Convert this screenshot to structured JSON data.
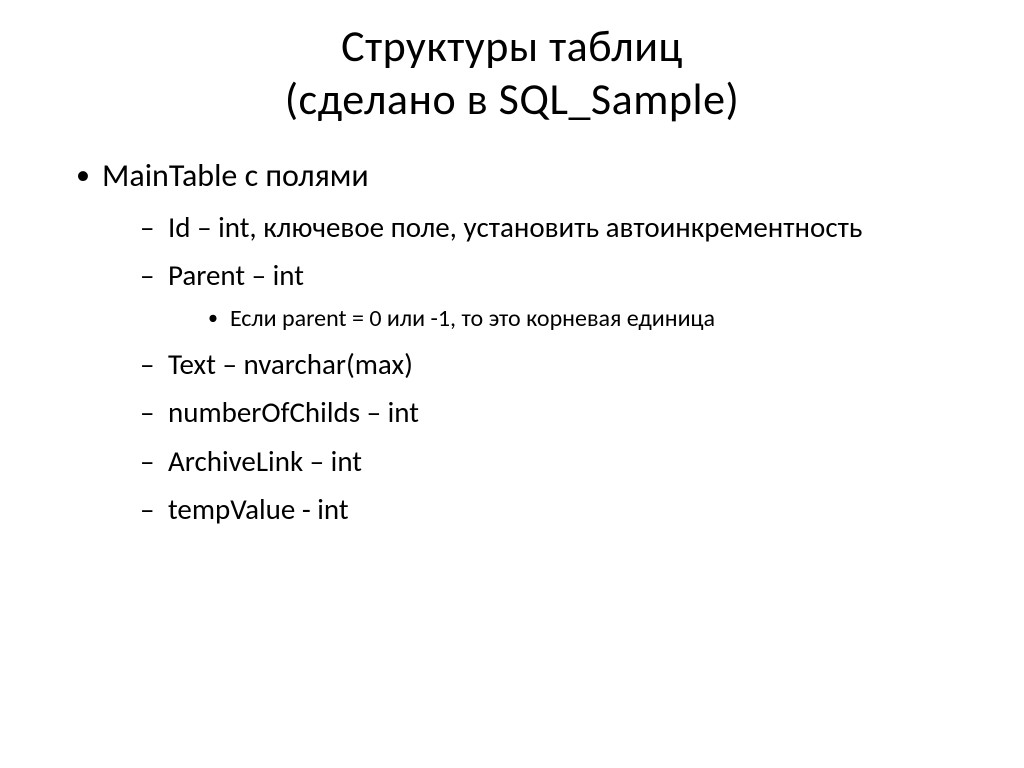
{
  "title_line1": "Структуры таблиц",
  "title_line2": "(сделано в SQL_Sample)",
  "bullet1": "MainTable с полями",
  "sub": {
    "id": "Id – int, ключевое поле, установить автоинкрементность",
    "parent": "Parent – int",
    "parent_note": "Если parent = 0 или -1, то это корневая единица",
    "text": "Text – nvarchar(max)",
    "numberOfChilds": "numberOfChilds – int",
    "archiveLink": "ArchiveLink – int",
    "tempValue": "tempValue - int"
  }
}
